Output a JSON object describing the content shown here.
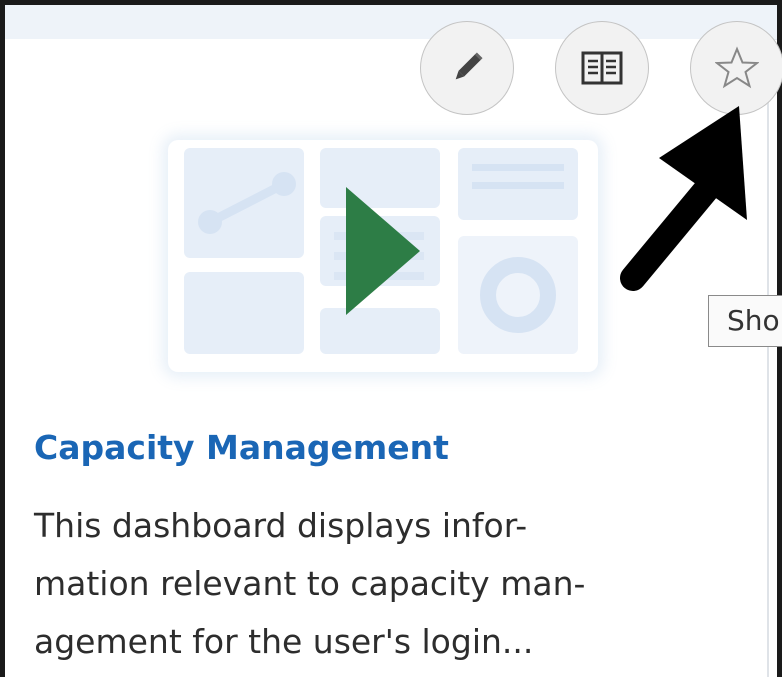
{
  "tile": {
    "title": "Capacity Management",
    "description_lines": [
      "This dashboard displays infor-",
      "mation relevant to capacity man-",
      "agement for the user's login..."
    ]
  },
  "actions": {
    "edit": {
      "icon": "pencil-icon"
    },
    "read": {
      "icon": "book-icon"
    },
    "favorite": {
      "icon": "star-icon"
    }
  },
  "tooltip": {
    "text": "Sho"
  },
  "colors": {
    "title": "#1a66b5",
    "play": "#2d7d46",
    "thumbnail_block": "#e6eef8",
    "arrow": "#000000"
  }
}
